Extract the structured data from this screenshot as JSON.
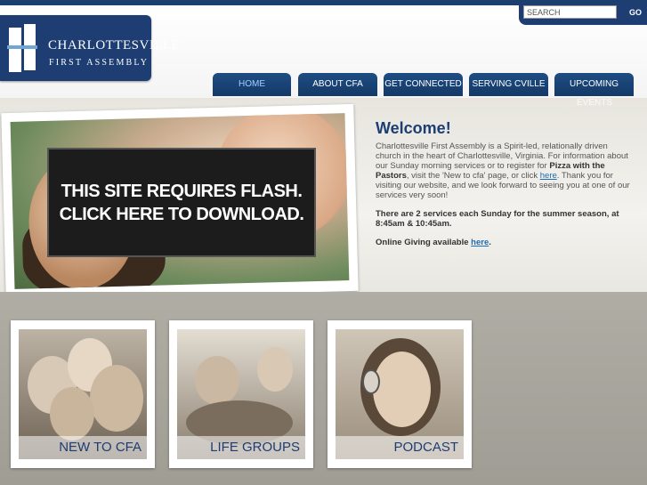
{
  "logo": {
    "name": "CHARLOTTESVILLE",
    "subtitle": "FIRST ASSEMBLY"
  },
  "search": {
    "placeholder": "SEARCH",
    "go_label": "GO"
  },
  "nav": {
    "home": "HOME",
    "about": "ABOUT CFA",
    "connected": "GET CONNECTED",
    "serving": "SERVING CVILLE",
    "upcoming": "UPCOMING",
    "overflow": "EVENTS"
  },
  "flash": {
    "line1": "THIS SITE REQUIRES FLASH.",
    "line2": "CLICK HERE TO DOWNLOAD."
  },
  "welcome": {
    "title": "Welcome!",
    "p1_a": "Charlottesville First Assembly is a Spirit-led, relationally driven church in the heart of Charlottesville, Virginia.  For information about our Sunday morning services or to register for ",
    "p1_bold": "Pizza with the Pastors",
    "p1_b": ", visit the 'New to cfa' page, or click ",
    "p1_link": "here",
    "p1_c": ".  Thank you for visiting our website, and we look forward to seeing you at one of our services very soon!",
    "p2": "There are 2 services each Sunday for the summer season, at 8:45am & 10:45am.",
    "p3_a": "Online Giving available ",
    "p3_link": "here",
    "p3_b": "."
  },
  "cards": [
    {
      "label": "NEW TO CFA"
    },
    {
      "label": "LIFE GROUPS"
    },
    {
      "label": "PODCAST"
    }
  ]
}
